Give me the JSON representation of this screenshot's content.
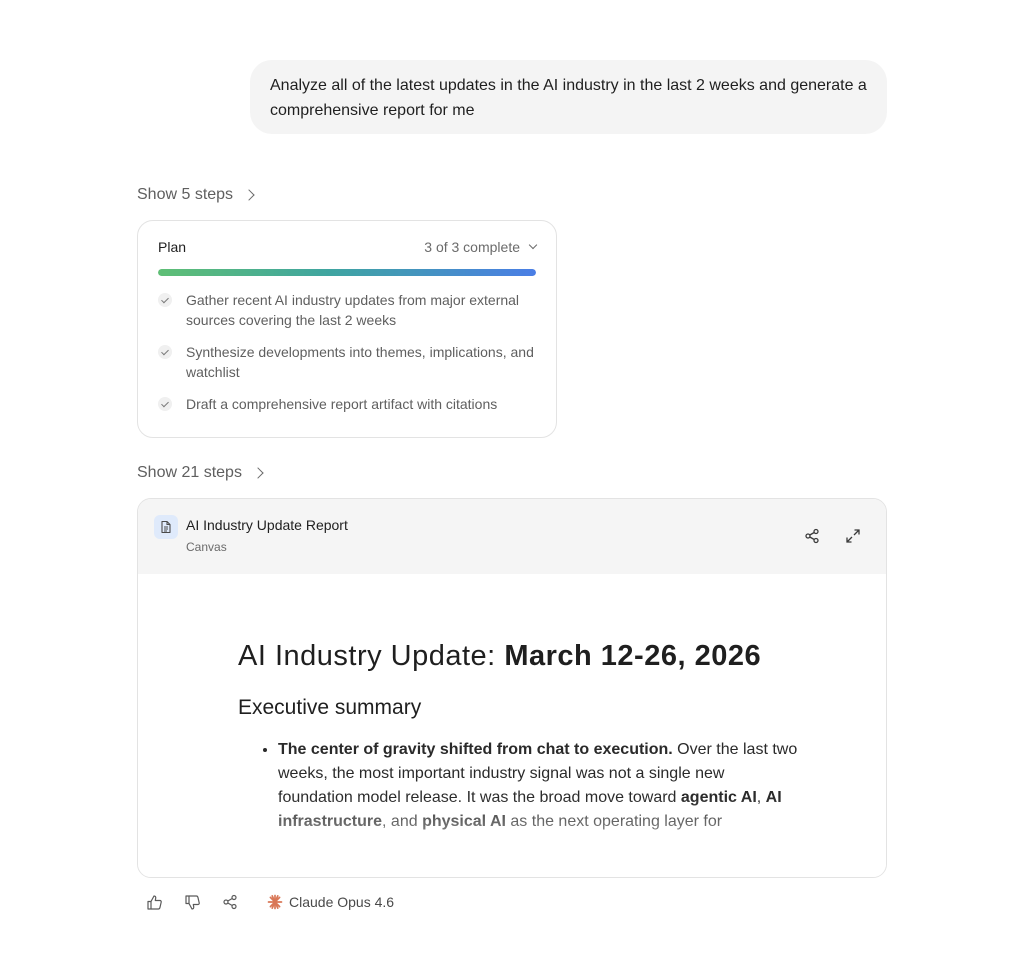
{
  "user_message": "Analyze all of the latest updates in the AI industry in the last 2 weeks and generate a comprehensive report for me",
  "steps_toggle_1": "Show 5 steps",
  "plan": {
    "title": "Plan",
    "status": "3 of 3 complete",
    "progress": 1.0,
    "items": [
      "Gather recent AI industry updates from major external sources covering the last 2 weeks",
      "Synthesize developments into themes, implications, and watchlist",
      "Draft a comprehensive report artifact with citations"
    ]
  },
  "steps_toggle_2": "Show 21 steps",
  "canvas": {
    "title": "AI Industry Update Report",
    "subtitle": "Canvas",
    "doc_title_prefix": "AI Industry Update: ",
    "doc_title_bold": "March 12-26, 2026",
    "section_heading": "Executive summary",
    "bullet_bold": "The center of gravity shifted from chat to execution.",
    "bullet_text_1": " Over the last two weeks, the most important industry signal was not a single new foundation model release. It was the broad move toward ",
    "bullet_term_1": "agentic AI",
    "bullet_sep_1": ", ",
    "bullet_term_2": "AI infrastructure",
    "bullet_text_2": ", and ",
    "bullet_term_3": "physical AI",
    "bullet_text_3": " as the next operating layer for"
  },
  "footer": {
    "model_name": "Claude Opus 4.6"
  },
  "icons": {
    "thumbs_up": "thumbs-up-icon",
    "thumbs_down": "thumbs-down-icon",
    "share": "share-icon",
    "expand": "expand-icon",
    "document": "document-icon",
    "claude_logo": "claude-logo-icon"
  },
  "colors": {
    "progress_start": "#5fbf75",
    "progress_end": "#4a7ee6",
    "claude_accent": "#d97757"
  }
}
